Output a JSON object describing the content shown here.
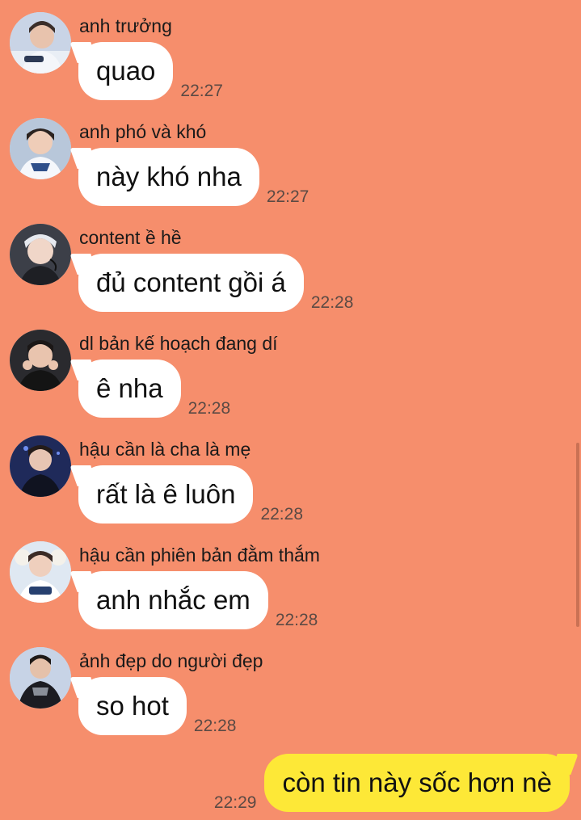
{
  "messages": [
    {
      "sender": "anh trưởng",
      "text": "quao",
      "time": "22:27",
      "avatar": "avatar-icon"
    },
    {
      "sender": "anh phó và khó",
      "text": "này khó nha",
      "time": "22:27",
      "avatar": "avatar-icon"
    },
    {
      "sender": "content ề hề",
      "text": "đủ content gồi á",
      "time": "22:28",
      "avatar": "avatar-icon"
    },
    {
      "sender": "dl bản kế hoạch đang dí",
      "text": "ê nha",
      "time": "22:28",
      "avatar": "avatar-icon"
    },
    {
      "sender": "hậu cần là cha là mẹ",
      "text": "rất là ê luôn",
      "time": "22:28",
      "avatar": "avatar-icon"
    },
    {
      "sender": "hậu cần phiên bản đằm thắm",
      "text": "anh nhắc em",
      "time": "22:28",
      "avatar": "avatar-icon"
    },
    {
      "sender": "ảnh đẹp do người đẹp",
      "text": "so hot",
      "time": "22:28",
      "avatar": "avatar-icon"
    }
  ],
  "my_message": {
    "text": "còn tin này sốc hơn nè",
    "time": "22:29"
  },
  "colors": {
    "background": "#F68E6C",
    "incoming_bubble": "#FFFFFF",
    "outgoing_bubble": "#FDE837"
  }
}
